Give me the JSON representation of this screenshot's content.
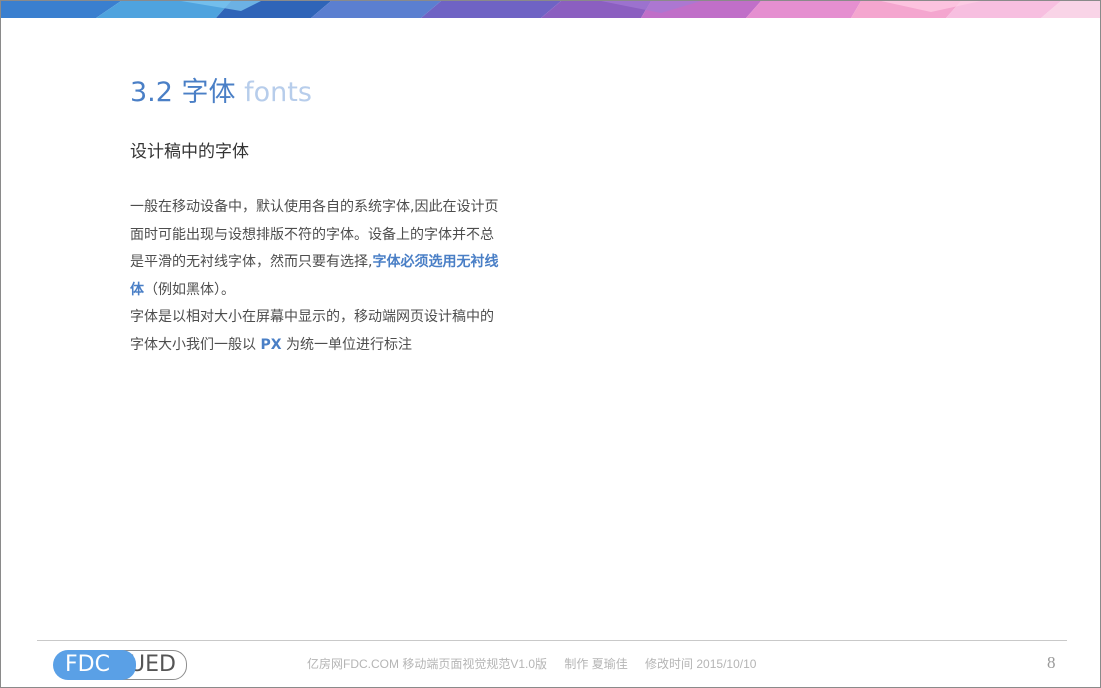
{
  "slide": {
    "title_number": "3.2",
    "title_zh": "字体",
    "title_en": "fonts",
    "subtitle": "设计稿中的字体",
    "body": {
      "line1": "一般在移动设备中，默认使用各自的系统字体,因此在设计页",
      "line2": "面时可能出现与设想排版不符的字体。设备上的字体并不总",
      "line3_prefix": "是平滑的无衬线字体，然而只要有选择,",
      "line3_highlight": "字体必须选用无衬线",
      "line4_highlight": "体",
      "line4_suffix": "（例如黑体）。",
      "line5": "字体是以相对大小在屏幕中显示的，移动端网页设计稿中的",
      "line6_prefix": "字体大小我们一般以 ",
      "line6_highlight": "PX",
      "line6_suffix": " 为统一单位进行标注"
    }
  },
  "footer": {
    "logo_left": "FDC",
    "logo_right": "UED",
    "doc_name": "亿房网FDC.COM 移动端页面视觉规范V1.0版",
    "author": "制作 夏瑜佳",
    "modified": "修改时间  2015/10/10",
    "page_number": "8"
  },
  "colors": {
    "accent": "#4a7fc6",
    "accent_light": "#b7cdeb",
    "logo_blue": "#5aa0e6"
  }
}
